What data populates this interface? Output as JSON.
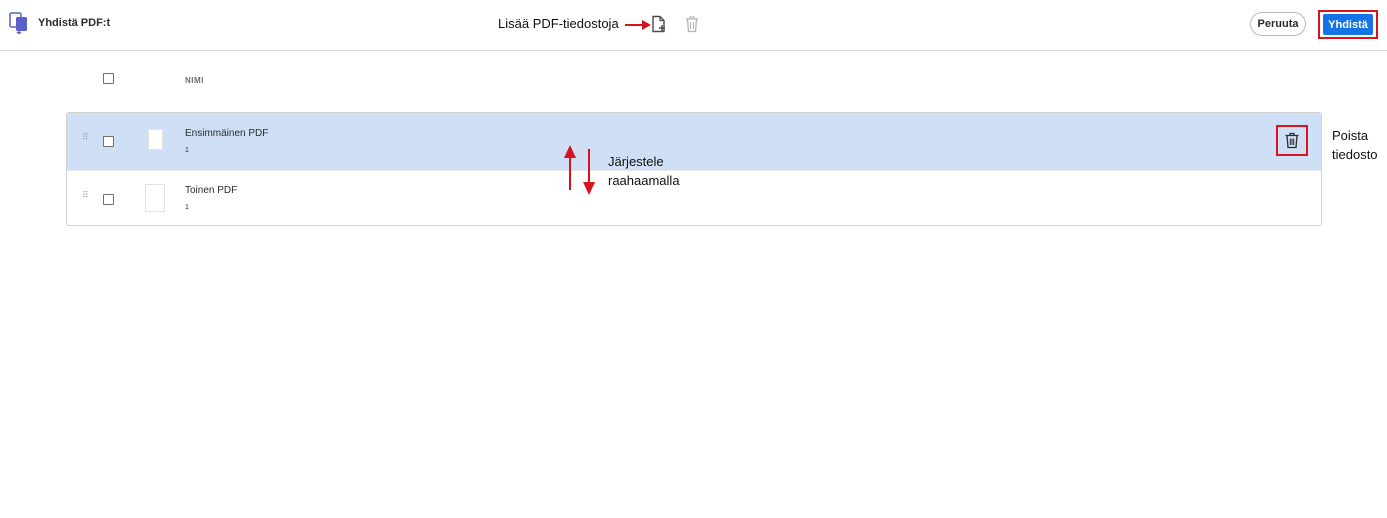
{
  "app": {
    "title": "Yhdistä PDF:t"
  },
  "toolbar": {
    "add_files_label": "Lisää PDF-tiedostoja"
  },
  "header_actions": {
    "cancel_label": "Peruuta",
    "combine_label": "Yhdistä"
  },
  "table": {
    "column_name": "NIMI"
  },
  "files": [
    {
      "name": "Ensimmäinen PDF",
      "pages": "1",
      "selected": true
    },
    {
      "name": "Toinen PDF",
      "pages": "1",
      "selected": false
    }
  ],
  "annotations": {
    "delete_line1": "Poista",
    "delete_line2": "tiedosto",
    "sort_line1": "Järjestele",
    "sort_line2": "raahaamalla"
  },
  "colors": {
    "accent": "#1473e6",
    "highlight": "#d7141e",
    "selected_row": "#cfe0f6",
    "app_icon": "#5b5fc7"
  },
  "icons": [
    "combine-pdf-icon",
    "add-file-icon",
    "trash-icon",
    "drag-handle-icon",
    "delete-icon"
  ]
}
